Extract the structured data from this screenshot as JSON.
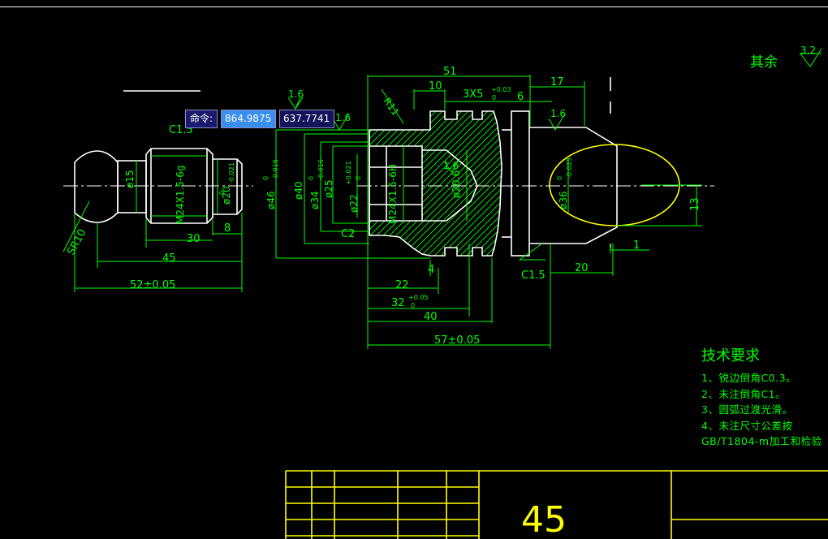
{
  "command": {
    "label": "命令:",
    "x_value": "864.9875",
    "y_value": "637.7741"
  },
  "roughness_note": {
    "label": "其余",
    "value": "3.2"
  },
  "tech_requirements": {
    "title": "技术要求",
    "lines": [
      "1、锐边倒角C0.3。",
      "2、未注倒角C1。",
      "3、圆弧过渡光滑。",
      "4、未注尺寸公差按",
      "GB/T1804-m加工和检验"
    ]
  },
  "title_block": {
    "material": "45"
  },
  "left_part": {
    "chamfer": "C1.5",
    "sr": "SR10",
    "d15": "ø15",
    "thread": "M24X1.5-6g",
    "d20": "ø20",
    "d20_tol_up": "0",
    "d20_tol_low": "-0.021",
    "dim30": "30",
    "dim8": "8",
    "dim45": "45",
    "dim52": "52±0.05"
  },
  "right_part": {
    "rough1": "1.6",
    "rough2": "1.6",
    "rough3": "1.6",
    "rough4": "1.6",
    "r11": "R11",
    "dim51": "51",
    "dim10": "10",
    "dim3x5": "3X5",
    "dim3x5_up": "+0.03",
    "dim3x5_low": "0",
    "dim6": "6",
    "dim17": "17",
    "d46": "ø46",
    "d46_up": "0",
    "d46_low": "-0.016",
    "d40": "ø40",
    "d34": "ø34",
    "d34_up": "0",
    "d34_low": "-0.016",
    "d25": "ø25",
    "d22": "ø22",
    "d22_up": "+0.021",
    "d22_low": "0",
    "thread": "M24X1.5-6H",
    "d20": "ø20.6",
    "d36": "ø36",
    "d36_up": "0",
    "d36_low": "-0.025",
    "c2": "C2",
    "c15": "C1.5",
    "dim4": "4",
    "dim22": "22",
    "dim32": "32",
    "dim32_up": "+0.05",
    "dim32_low": "0",
    "dim40": "40",
    "dim57": "57±0.05",
    "dim20": "20",
    "dim13": "13",
    "dim1": "1"
  }
}
